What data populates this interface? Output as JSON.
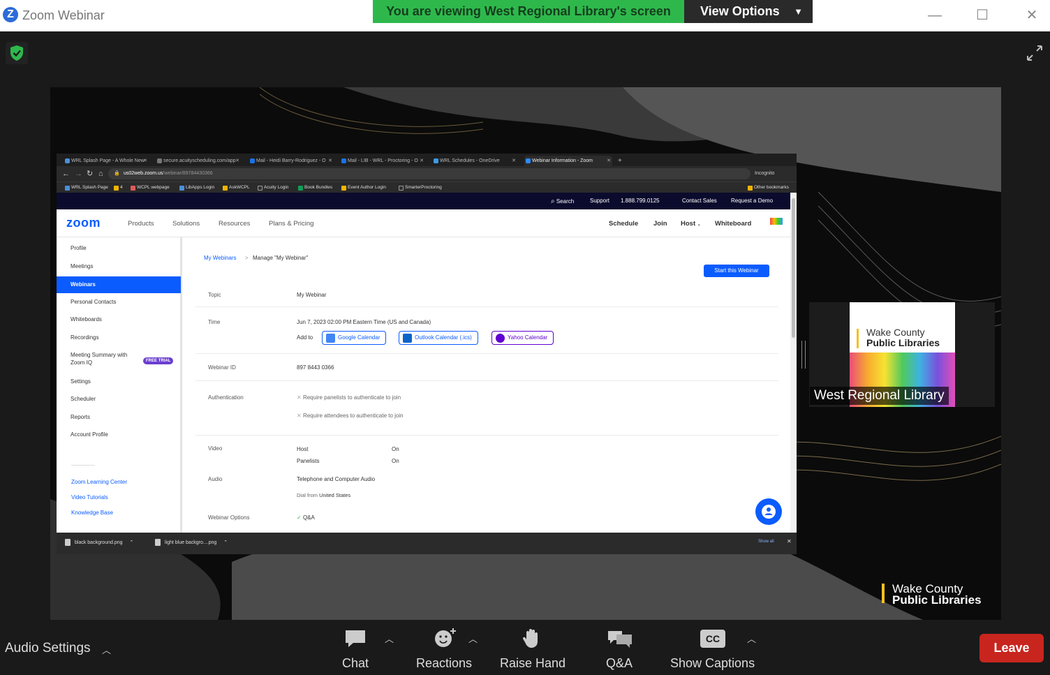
{
  "app": {
    "title": "Zoom Webinar",
    "logo_letter": "Z"
  },
  "banner": {
    "viewing_text": "You are viewing West Regional Library's screen",
    "view_options_label": "View Options"
  },
  "window_controls": {
    "minimize": "—",
    "maximize": "☐",
    "close": "✕"
  },
  "browser": {
    "tabs": [
      {
        "label": "WRL Splash Page - A Whole New",
        "color": "#4a90d9"
      },
      {
        "label": "secure.acuityscheduling.com/app",
        "color": "#777"
      },
      {
        "label": "Mail - Heidi Barry-Rodriguez - O",
        "color": "#1a73e8"
      },
      {
        "label": "Mail - LIB - WRL - Proctoring - O",
        "color": "#1a73e8"
      },
      {
        "label": "WRL Schedules - OneDrive",
        "color": "#3b9be8"
      },
      {
        "label": "Webinar Information - Zoom",
        "color": "#2d8cff"
      }
    ],
    "url": "us02web.zoom.us/webinar/89784430366",
    "url_host": "us02web.zoom.us",
    "url_path": "/webinar/89784430366",
    "incognito_label": "Incognito",
    "bookmarks": [
      {
        "label": "WRL Splash Page",
        "color": "#4a90d9"
      },
      {
        "label": "4",
        "color": "#f4b400"
      },
      {
        "label": "WCPL webpage",
        "color": "#e05a5a"
      },
      {
        "label": "LibApps Login",
        "color": "#4a90d9"
      },
      {
        "label": "AskWCPL",
        "color": "#f4b400"
      },
      {
        "label": "Acuity Login",
        "color": "#333"
      },
      {
        "label": "Book Bundles",
        "color": "#0f9d58"
      },
      {
        "label": "Event Author Login",
        "color": "#f4b400"
      },
      {
        "label": "SmarterProctoring",
        "color": "#333"
      }
    ],
    "other_bookmarks": "Other bookmarks",
    "downloads": [
      {
        "label": "black background.png"
      },
      {
        "label": "light blue backgro....png"
      }
    ],
    "show_all": "Show all"
  },
  "zoom_site": {
    "top_links": {
      "search": "Search",
      "support": "Support",
      "phone": "1.888.799.0125",
      "contact_sales": "Contact Sales",
      "request_demo": "Request a Demo"
    },
    "logo_text": "zoom",
    "nav_left": [
      "Products",
      "Solutions",
      "Resources",
      "Plans & Pricing"
    ],
    "nav_right": {
      "schedule": "Schedule",
      "join": "Join",
      "host": "Host",
      "whiteboard": "Whiteboard"
    },
    "sidebar": [
      {
        "label": "Profile"
      },
      {
        "label": "Meetings"
      },
      {
        "label": "Webinars"
      },
      {
        "label": "Personal Contacts"
      },
      {
        "label": "Whiteboards"
      },
      {
        "label": "Recordings"
      },
      {
        "label": "Meeting Summary with Zoom IQ"
      },
      {
        "label": "Settings"
      },
      {
        "label": "Scheduler"
      },
      {
        "label": "Reports"
      },
      {
        "label": "Account Profile"
      }
    ],
    "free_trial_badge": "FREE TRIAL",
    "sidebar_links": [
      "Zoom Learning Center",
      "Video Tutorials",
      "Knowledge Base"
    ],
    "breadcrumb": {
      "root": "My Webinars",
      "sep": ">",
      "current": "Manage \"My Webinar\""
    },
    "start_button": "Start this Webinar",
    "details": {
      "topic_label": "Topic",
      "topic_value": "My Webinar",
      "time_label": "Time",
      "time_value": "Jun 7, 2023 02:00 PM Eastern Time (US and Canada)",
      "add_to": "Add to",
      "calendars": [
        "Google Calendar",
        "Outlook Calendar (.ics)",
        "Yahoo Calendar"
      ],
      "id_label": "Webinar ID",
      "id_value": "897 8443 0366",
      "auth_label": "Authentication",
      "auth_items": [
        "Require panelists to authenticate to join",
        "Require attendees to authenticate to join"
      ],
      "video_label": "Video",
      "video_host": "Host",
      "video_host_value": "On",
      "video_panelists": "Panelists",
      "video_panelists_value": "On",
      "audio_label": "Audio",
      "audio_value": "Telephone and Computer Audio",
      "dial_from": "Dial from",
      "dial_country": "United States",
      "options_label": "Webinar Options",
      "options_first": "Q&A"
    }
  },
  "participant": {
    "name": "West Regional Library",
    "logo_line1": "Wake County",
    "logo_line2": "Public Libraries"
  },
  "watermark": {
    "line1": "Wake County",
    "line2": "Public Libraries"
  },
  "toolbar": {
    "audio_settings": "Audio Settings",
    "chat": "Chat",
    "reactions": "Reactions",
    "raise_hand": "Raise Hand",
    "qa": "Q&A",
    "show_captions": "Show Captions",
    "cc": "CC",
    "leave": "Leave"
  },
  "colors": {
    "banner_green": "#2eb84c",
    "zoom_blue": "#0b5cff",
    "leave_red": "#c8251e"
  }
}
